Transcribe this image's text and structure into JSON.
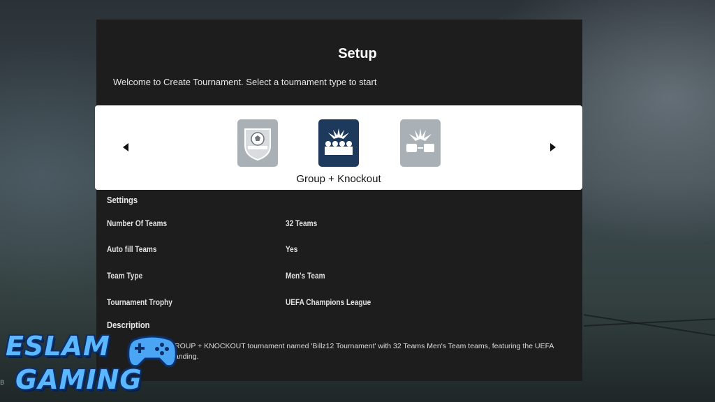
{
  "setup": {
    "title": "Setup",
    "subtitle": "Welcome to Create Tournament. Select a toumament type to start"
  },
  "carousel": {
    "selected_label": "Group + Knockout",
    "tiles": [
      {
        "icon": "shield-ball-icon"
      },
      {
        "icon": "group-knockout-icon"
      },
      {
        "icon": "knockout-icon"
      }
    ]
  },
  "settings": {
    "heading": "Settings",
    "rows": [
      {
        "label": "Number Of Teams",
        "value": "32 Teams"
      },
      {
        "label": "Auto fill Teams",
        "value": "Yes"
      },
      {
        "label": "Team Type",
        "value": "Men's Team"
      },
      {
        "label": "Tournament Trophy",
        "value": "UEFA Champions League"
      }
    ]
  },
  "description": {
    "heading": "Description",
    "line1": "ROUP + KNOCKOUT tournament named 'Billz12 Tournament' with 32 Teams Men's Team teams, featuring the UEFA",
    "line2": "anding."
  },
  "watermark": {
    "line1": "ESLAM",
    "line2": "GAMING",
    "corner": "B"
  },
  "colors": {
    "panel": "#1d1d1d",
    "carousel": "#ffffff",
    "selected_tile": "#1d3a5c",
    "tile": "#a9b0b6",
    "logo": "#5bb8ff"
  }
}
